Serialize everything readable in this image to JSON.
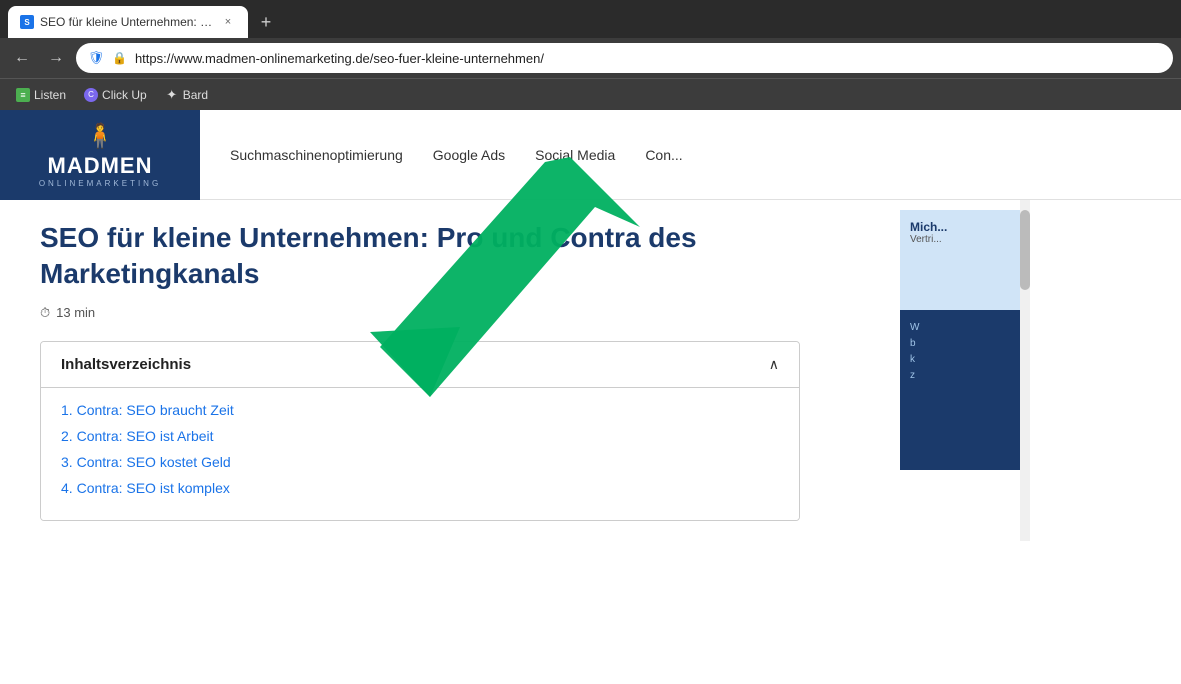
{
  "browser": {
    "tab": {
      "favicon_label": "S",
      "title": "SEO für kleine Unternehmen: Pr...",
      "close_label": "×",
      "new_tab_label": "+"
    },
    "nav": {
      "back_label": "←",
      "forward_label": "→",
      "shield_icon": "🛡",
      "lock_icon": "🔒",
      "url": "https://www.madmen-onlinemarketing.de/seo-fuer-kleine-unternehmen/"
    },
    "bookmarks": [
      {
        "id": "listen",
        "icon": "≡",
        "label": "Listen",
        "type": "listen"
      },
      {
        "id": "clickup",
        "icon": "C",
        "label": "Click Up",
        "type": "clickup"
      },
      {
        "id": "bard",
        "icon": "✦",
        "label": "Bard",
        "type": "bard"
      }
    ]
  },
  "site": {
    "logo": {
      "main": "MADMEN",
      "sub": "ONLINEMARKETING"
    },
    "nav_links": [
      {
        "id": "suchmaschinen",
        "label": "Suchmaschinenoptimierung"
      },
      {
        "id": "google-ads",
        "label": "Google Ads"
      },
      {
        "id": "social-media",
        "label": "Social Media"
      },
      {
        "id": "con",
        "label": "Con..."
      }
    ],
    "article": {
      "title": "SEO für kleine Unternehmen: Pro und Contra des Marketingkanals",
      "read_time_icon": "⏱",
      "read_time": "13 min",
      "toc": {
        "header": "Inhaltsverzeichnis",
        "chevron": "∧",
        "items": [
          {
            "num": "1.",
            "text": "Contra: SEO braucht Zeit"
          },
          {
            "num": "2.",
            "text": "Contra: SEO ist Arbeit"
          },
          {
            "num": "3.",
            "text": "Contra: SEO kostet Geld"
          },
          {
            "num": "4.",
            "text": "Contra: SEO ist komplex"
          }
        ]
      }
    },
    "sidebar": {
      "name": "Mich...",
      "role": "Vertri...",
      "cta_text": "W\nb\nk\nz"
    }
  }
}
